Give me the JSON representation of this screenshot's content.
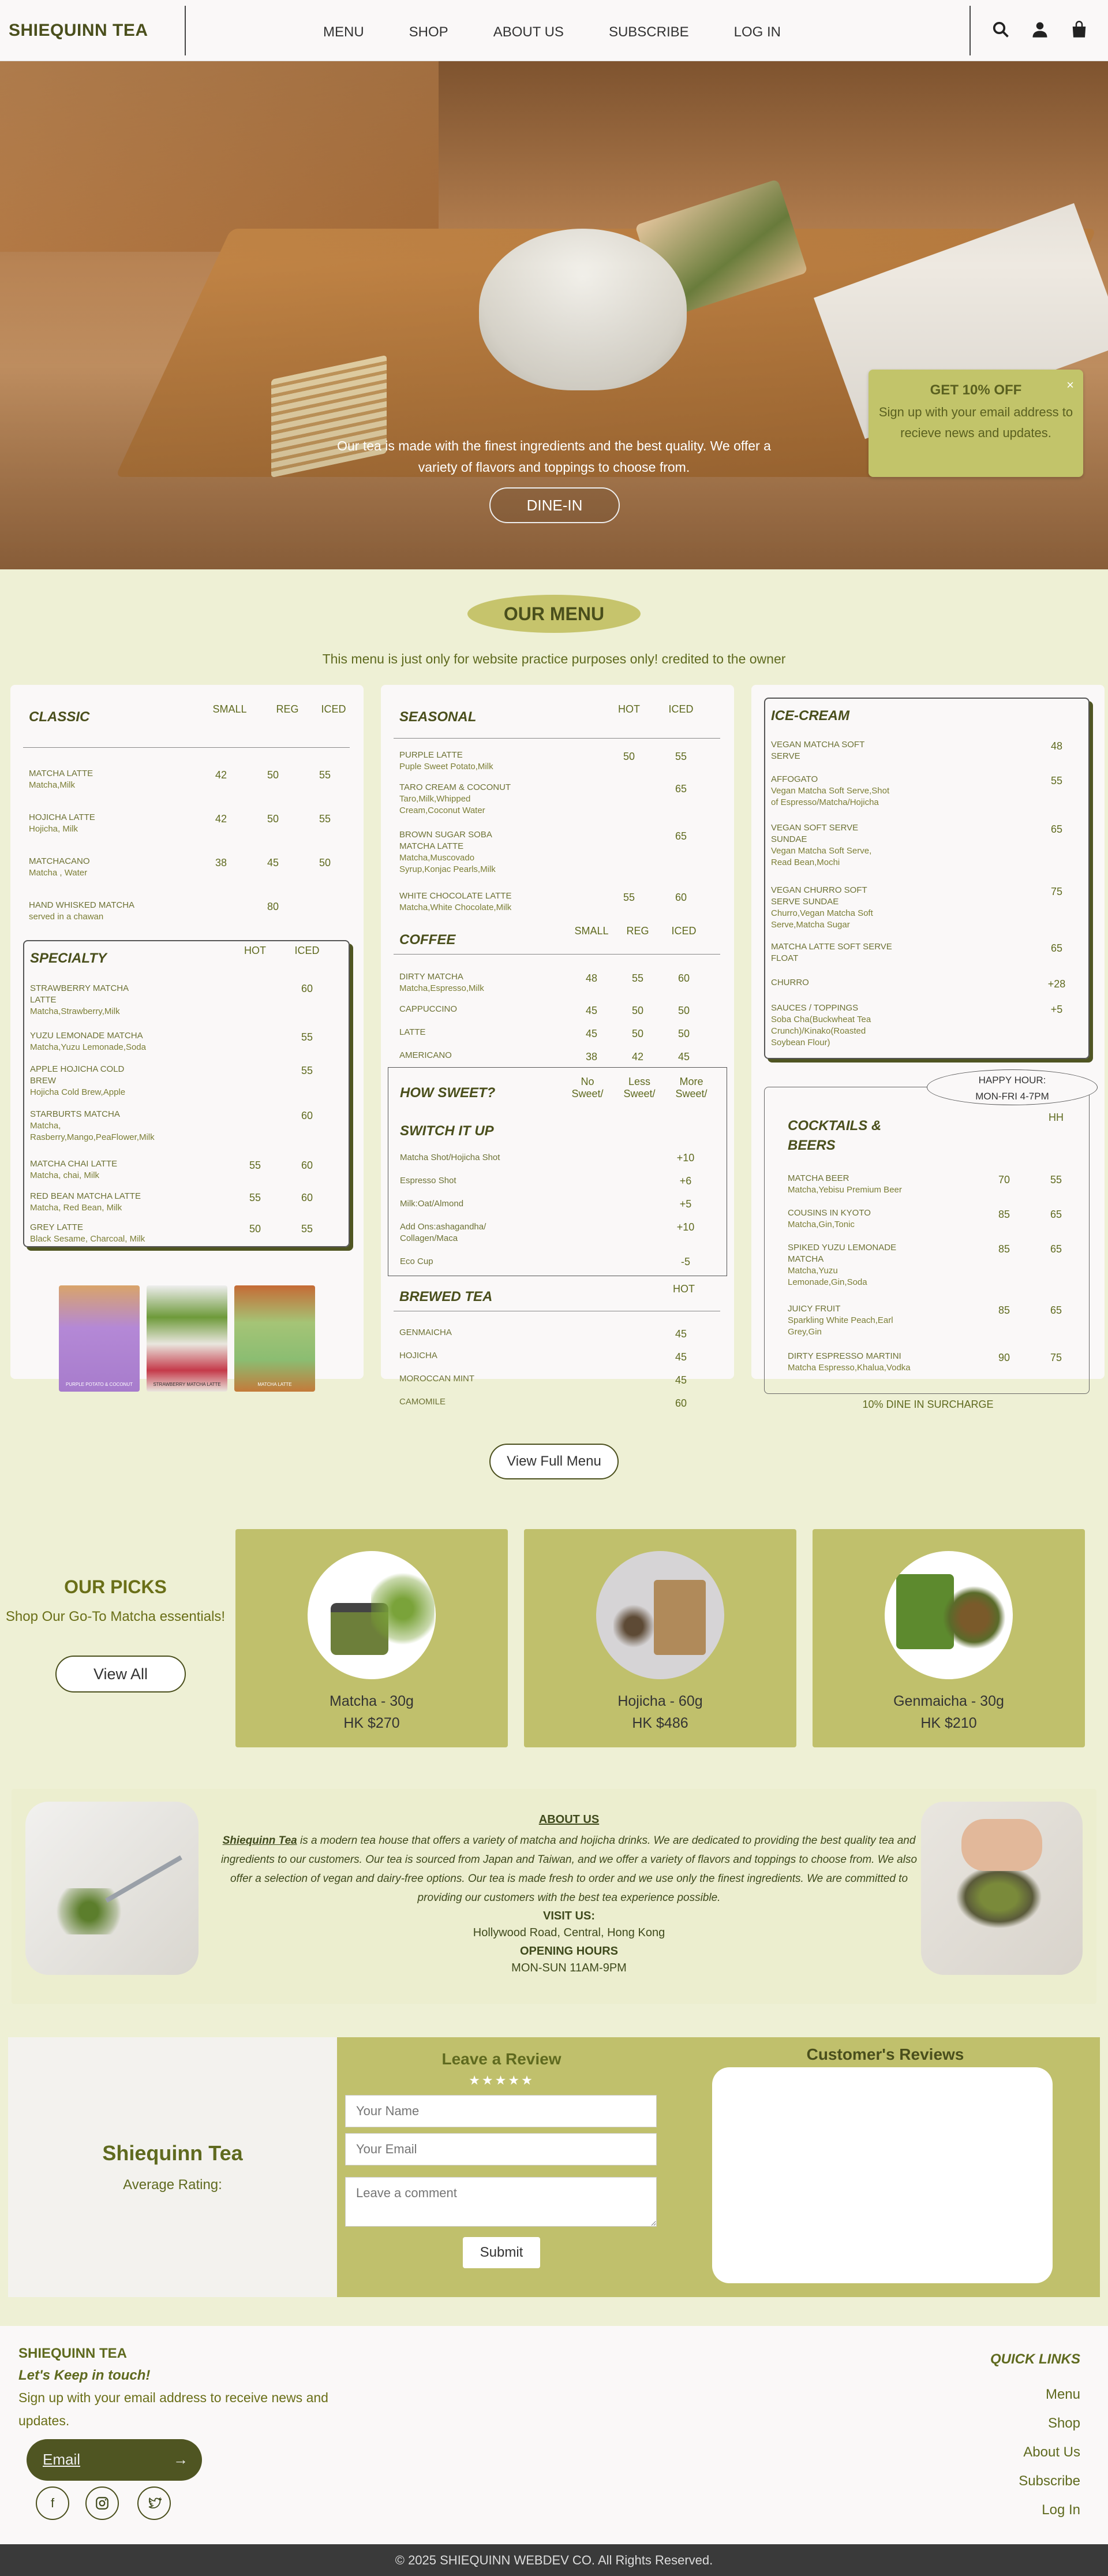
{
  "header": {
    "brand": "SHIEQUINN TEA",
    "nav": [
      "MENU",
      "SHOP",
      "ABOUT US",
      "SUBSCRIBE",
      "LOG IN"
    ],
    "icons": [
      "search-icon",
      "user-icon",
      "bag-icon"
    ]
  },
  "hero": {
    "lead": "Our tea is made with the finest ingredients and the best quality. We offer a variety of flavors and toppings to choose from.",
    "cta": "DINE-IN"
  },
  "promo": {
    "title": "GET 10% OFF",
    "body": "Sign up with your email address to recieve news and updates.",
    "close": "×"
  },
  "menu": {
    "pill": "OUR MENU",
    "note": "This menu is just only for website practice purposes only! credited to the owner",
    "classic": {
      "title": "CLASSIC",
      "cols": [
        "SMALL",
        "REG",
        "ICED"
      ],
      "items": [
        {
          "name": "MATCHA LATTE",
          "desc": "Matcha,Milk",
          "p": [
            "42",
            "50",
            "55"
          ]
        },
        {
          "name": "HOJICHA LATTE",
          "desc": "Hojicha, Milk",
          "p": [
            "42",
            "50",
            "55"
          ]
        },
        {
          "name": "MATCHACANO",
          "desc": "Matcha , Water",
          "p": [
            "38",
            "45",
            "50"
          ]
        },
        {
          "name": "HAND WHISKED MATCHA",
          "desc": "served in a chawan",
          "p": [
            "",
            "80",
            ""
          ]
        }
      ]
    },
    "specialty": {
      "title": "SPECIALTY",
      "cols": [
        "HOT",
        "ICED"
      ],
      "items": [
        {
          "name": "STRAWBERRY MATCHA LATTE",
          "desc": "Matcha,Strawberry,Milk",
          "p": [
            "",
            "60"
          ]
        },
        {
          "name": "YUZU LEMONADE MATCHA",
          "desc": "Matcha,Yuzu Lemonade,Soda",
          "p": [
            "",
            "55"
          ]
        },
        {
          "name": "APPLE HOJICHA COLD BREW",
          "desc": "Hojicha Cold Brew,Apple",
          "p": [
            "",
            "55"
          ]
        },
        {
          "name": "STARBURTS MATCHA",
          "desc": "Matcha, Rasberry,Mango,PeaFlower,Milk",
          "p": [
            "",
            "60"
          ]
        },
        {
          "name": "MATCHA CHAI LATTE",
          "desc": "Matcha, chai, Milk",
          "p": [
            "55",
            "60"
          ]
        },
        {
          "name": "RED BEAN MATCHA LATTE",
          "desc": "Matcha, Red Bean, Milk",
          "p": [
            "55",
            "60"
          ]
        },
        {
          "name": "GREY LATTE",
          "desc": "Black Sesame, Charcoal, Milk",
          "p": [
            "50",
            "55"
          ]
        }
      ]
    },
    "thumbs": [
      "PURPLE POTATO & COCONUT",
      "STRAWBERRY MATCHA LATTE",
      "MATCHA LATTE"
    ],
    "seasonal": {
      "title": "SEASONAL",
      "cols": [
        "HOT",
        "ICED"
      ],
      "items": [
        {
          "name": "PURPLE LATTE",
          "desc": "Puple Sweet Potato,Milk",
          "p": [
            "50",
            "55"
          ]
        },
        {
          "name": "TARO CREAM & COCONUT",
          "desc": "Taro,Milk,Whipped Cream,Coconut Water",
          "p": [
            "",
            "65"
          ]
        },
        {
          "name": "BROWN SUGAR SOBA MATCHA LATTE",
          "desc": "Matcha,Muscovado Syrup,Konjac Pearls,Milk",
          "p": [
            "",
            "65"
          ]
        },
        {
          "name": "WHITE CHOCOLATE LATTE",
          "desc": "Matcha,White Chocolate,Milk",
          "p": [
            "55",
            "60"
          ]
        }
      ]
    },
    "coffee": {
      "title": "COFFEE",
      "cols": [
        "SMALL",
        "REG",
        "ICED"
      ],
      "items": [
        {
          "name": "DIRTY MATCHA",
          "desc": "Matcha,Espresso,Milk",
          "p": [
            "48",
            "55",
            "60"
          ]
        },
        {
          "name": "CAPPUCCINO",
          "desc": "",
          "p": [
            "45",
            "50",
            "50"
          ]
        },
        {
          "name": "LATTE",
          "desc": "",
          "p": [
            "45",
            "50",
            "50"
          ]
        },
        {
          "name": "AMERICANO",
          "desc": "",
          "p": [
            "38",
            "42",
            "45"
          ]
        }
      ]
    },
    "sweet": {
      "title": "HOW SWEET?",
      "cols": [
        "No Sweet/",
        "Less Sweet/",
        "More Sweet/"
      ],
      "switch": "SWITCH IT UP",
      "items": [
        {
          "name": "Matcha Shot/Hojicha Shot",
          "p": "+10"
        },
        {
          "name": "Espresso Shot",
          "p": "+6"
        },
        {
          "name": "Milk:Oat/Almond",
          "p": "+5"
        },
        {
          "name": "Add Ons:ashagandha/ Collagen/Maca",
          "p": "+10"
        },
        {
          "name": "Eco Cup",
          "p": "-5"
        }
      ]
    },
    "brewed": {
      "title": "BREWED TEA",
      "col": "HOT",
      "items": [
        {
          "name": "GENMAICHA",
          "p": "45"
        },
        {
          "name": "HOJICHA",
          "p": "45"
        },
        {
          "name": "MOROCCAN MINT",
          "p": "45"
        },
        {
          "name": "CAMOMILE",
          "p": "60"
        }
      ]
    },
    "icecream": {
      "title": "ICE-CREAM",
      "items": [
        {
          "name": "VEGAN MATCHA SOFT SERVE",
          "desc": "",
          "p": "48"
        },
        {
          "name": "AFFOGATO",
          "desc": "Vegan Matcha Soft Serve,Shot of Espresso/Matcha/Hojicha",
          "p": "55"
        },
        {
          "name": "VEGAN SOFT SERVE SUNDAE",
          "desc": "Vegan Matcha Soft Serve, Read Bean,Mochi",
          "p": "65"
        },
        {
          "name": "VEGAN CHURRO SOFT SERVE SUNDAE",
          "desc": "Churro,Vegan Matcha Soft Serve,Matcha Sugar",
          "p": "75"
        },
        {
          "name": "MATCHA LATTE SOFT SERVE FLOAT",
          "desc": "",
          "p": "65"
        },
        {
          "name": "CHURRO",
          "desc": "",
          "p": "+28"
        },
        {
          "name": "SAUCES / TOPPINGS",
          "desc": "Soba Cha(Buckwheat Tea Crunch)/Kinako(Roasted Soybean Flour)",
          "p": "+5"
        }
      ]
    },
    "happy": {
      "line1": "HAPPY HOUR:",
      "line2": "MON-FRI 4-7PM",
      "hh": "HH"
    },
    "cocktails": {
      "title": "COCKTAILS & BEERS",
      "items": [
        {
          "name": "MATCHA BEER",
          "desc": "Matcha,Yebisu Premium Beer",
          "p": [
            "70",
            "55"
          ]
        },
        {
          "name": "COUSINS IN KYOTO",
          "desc": "Matcha,Gin,Tonic",
          "p": [
            "85",
            "65"
          ]
        },
        {
          "name": "SPIKED YUZU LEMONADE MATCHA",
          "desc": "Matcha,Yuzu Lemonade,Gin,Soda",
          "p": [
            "85",
            "65"
          ]
        },
        {
          "name": "JUICY FRUIT",
          "desc": "Sparkling White Peach,Earl Grey,Gin",
          "p": [
            "85",
            "65"
          ]
        },
        {
          "name": "DIRTY ESPRESSO MARTINI",
          "desc": "Matcha Espresso,Khalua,Vodka",
          "p": [
            "90",
            "75"
          ]
        }
      ]
    },
    "surcharge": "10% DINE IN SURCHARGE",
    "viewfull": "View Full Menu"
  },
  "picks": {
    "title": "OUR PICKS",
    "sub": "Shop Our Go-To Matcha essentials!",
    "btn": "View All",
    "products": [
      {
        "name": "Matcha - 30g",
        "price": "HK $270"
      },
      {
        "name": "Hojicha - 60g",
        "price": "HK $486"
      },
      {
        "name": "Genmaicha - 30g",
        "price": "HK $210"
      }
    ]
  },
  "about": {
    "title": "ABOUT US",
    "brand": "Shiequinn Tea",
    "body": " is a modern tea house that offers a variety of matcha and hojicha drinks. We are dedicated to providing the best quality tea and ingredients to our customers. Our tea is sourced from Japan and Taiwan, and we offer a variety of flavors and toppings to choose from. We also offer a selection of vegan and dairy-free options. Our tea is made fresh to order and we use only the finest ingredients. We are committed to providing our customers with the best tea experience possible.",
    "visit_label": "VISIT US:",
    "address": "Hollywood Road, Central, Hong Kong",
    "hours_label": "OPENING HOURS",
    "hours": "MON-SUN 11AM-9PM"
  },
  "review": {
    "name": "Shiequinn Tea",
    "avg": "Average Rating:",
    "form_title": "Leave a Review",
    "stars": "★★★★★",
    "name_ph": "Your Name",
    "email_ph": "Your Email",
    "comment_ph": "Leave a comment",
    "submit": "Submit",
    "reviews_title": "Customer's Reviews"
  },
  "footer": {
    "brand": "SHIEQUINN TEA",
    "keep": "Let's Keep in touch!",
    "signup": "Sign up with your email address to receive news and updates.",
    "email": "Email",
    "social": [
      "facebook-icon",
      "instagram-icon",
      "twitter-icon"
    ],
    "ql_title": "QUICK LINKS",
    "links": [
      "Menu",
      "Shop",
      "About Us",
      "Subscribe",
      "Log In"
    ],
    "copy": "© 2025 SHIEQUINN WEBDEV CO. All Rights Reserved."
  },
  "colors": {
    "olive": "#c0c06c",
    "dark": "#4f5522",
    "bg": "#eef0d5"
  }
}
